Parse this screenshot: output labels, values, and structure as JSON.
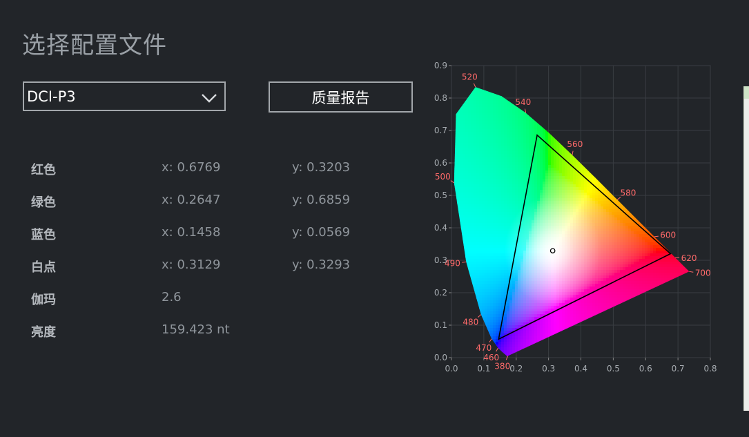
{
  "title": "选择配置文件",
  "profile_select": {
    "value": "DCI-P3"
  },
  "report_button": {
    "label": "质量报告"
  },
  "info": [
    {
      "label": "红色",
      "x": "x: 0.6769",
      "y": "y: 0.3203"
    },
    {
      "label": "绿色",
      "x": "x: 0.2647",
      "y": "y: 0.6859"
    },
    {
      "label": "蓝色",
      "x": "x: 0.1458",
      "y": "y: 0.0569"
    },
    {
      "label": "白点",
      "x": "x: 0.3129",
      "y": "y: 0.3293"
    },
    {
      "label": "伽玛",
      "x": "2.6",
      "y": ""
    },
    {
      "label": "亮度",
      "x": "159.423 nt",
      "y": ""
    }
  ],
  "colors": {
    "background": "#222529",
    "text_label": "#b4b8bd",
    "text_value": "#8f959b",
    "border": "#a3a7ab",
    "wavelength_label": "#ff6a6a"
  },
  "chart_data": {
    "type": "scatter",
    "title": "",
    "xlabel": "",
    "ylabel": "",
    "xlim": [
      0.0,
      0.8
    ],
    "ylim": [
      0.0,
      0.9
    ],
    "x_ticks": [
      "0.0",
      "0.1",
      "0.2",
      "0.3",
      "0.4",
      "0.5",
      "0.6",
      "0.7",
      "0.8"
    ],
    "y_ticks": [
      "0.0",
      "0.1",
      "0.2",
      "0.3",
      "0.4",
      "0.5",
      "0.6",
      "0.7",
      "0.8",
      "0.9"
    ],
    "grid": true,
    "wavelength_labels": [
      {
        "text": "380",
        "x": 0.1741,
        "y": 0.005
      },
      {
        "text": "460",
        "x": 0.144,
        "y": 0.0297
      },
      {
        "text": "470",
        "x": 0.1241,
        "y": 0.0578
      },
      {
        "text": "480",
        "x": 0.0913,
        "y": 0.1327
      },
      {
        "text": "490",
        "x": 0.0454,
        "y": 0.295
      },
      {
        "text": "500",
        "x": 0.0082,
        "y": 0.5384
      },
      {
        "text": "520",
        "x": 0.0743,
        "y": 0.8338
      },
      {
        "text": "540",
        "x": 0.2296,
        "y": 0.7543
      },
      {
        "text": "560",
        "x": 0.3731,
        "y": 0.6245
      },
      {
        "text": "580",
        "x": 0.5125,
        "y": 0.4866
      },
      {
        "text": "600",
        "x": 0.627,
        "y": 0.3725
      },
      {
        "text": "620",
        "x": 0.6915,
        "y": 0.3083
      },
      {
        "text": "700",
        "x": 0.7347,
        "y": 0.2653
      }
    ],
    "gamut_triangle": [
      {
        "name": "red",
        "x": 0.6769,
        "y": 0.3203
      },
      {
        "name": "green",
        "x": 0.2647,
        "y": 0.6859
      },
      {
        "name": "blue",
        "x": 0.1458,
        "y": 0.0569
      }
    ],
    "white_point": {
      "x": 0.3129,
      "y": 0.3293
    }
  }
}
